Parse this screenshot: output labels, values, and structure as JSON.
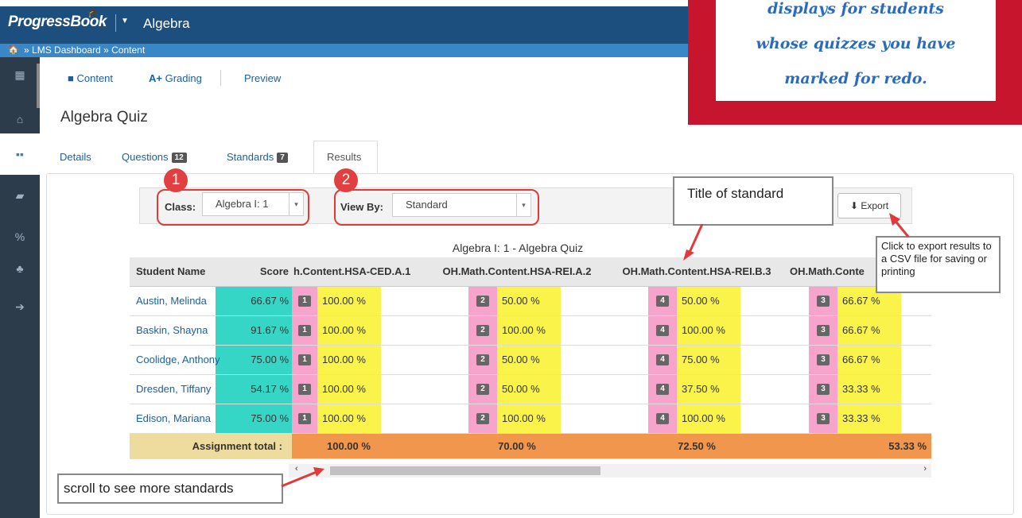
{
  "header": {
    "brand": "ProgressBook",
    "app": "Algebra"
  },
  "breadcrumb": {
    "home_icon": "home-icon",
    "items": [
      "LMS Dashboard",
      "Content"
    ],
    "separator": "»"
  },
  "toolbar": {
    "content": "Content",
    "grading": "Grading",
    "preview": "Preview"
  },
  "page_title": "Algebra Quiz",
  "tabs": [
    {
      "label": "Details"
    },
    {
      "label": "Questions",
      "badge": "12"
    },
    {
      "label": "Standards",
      "badge": "7"
    },
    {
      "label": "Results"
    }
  ],
  "filters": {
    "class_label": "Class:",
    "class_value": "Algebra I: 1",
    "viewby_label": "View By:",
    "viewby_value": "Standard",
    "export_label": "Export"
  },
  "grid_title": "Algebra I: 1 - Algebra Quiz",
  "columns": [
    "Student Name",
    "Score",
    "h.Content.HSA-CED.A.1",
    "OH.Math.Content.HSA-REI.A.2",
    "OH.Math.Content.HSA-REI.B.3",
    "OH.Math.Conte"
  ],
  "rows": [
    {
      "name": "Austin, Melinda",
      "score": "66.67 %",
      "vals": [
        [
          "1",
          "100.00 %"
        ],
        [
          "2",
          "50.00 %"
        ],
        [
          "4",
          "50.00 %"
        ],
        [
          "3",
          "66.67 %"
        ]
      ]
    },
    {
      "name": "Baskin, Shayna",
      "score": "91.67 %",
      "vals": [
        [
          "1",
          "100.00 %"
        ],
        [
          "2",
          "100.00 %"
        ],
        [
          "4",
          "100.00 %"
        ],
        [
          "3",
          "66.67 %"
        ]
      ]
    },
    {
      "name": "Coolidge, Anthony",
      "score": "75.00 %",
      "vals": [
        [
          "1",
          "100.00 %"
        ],
        [
          "2",
          "50.00 %"
        ],
        [
          "4",
          "75.00 %"
        ],
        [
          "3",
          "66.67 %"
        ]
      ]
    },
    {
      "name": "Dresden, Tiffany",
      "score": "54.17 %",
      "vals": [
        [
          "1",
          "100.00 %"
        ],
        [
          "2",
          "50.00 %"
        ],
        [
          "4",
          "37.50 %"
        ],
        [
          "3",
          "33.33 %"
        ]
      ]
    },
    {
      "name": "Edison, Mariana",
      "score": "75.00 %",
      "vals": [
        [
          "1",
          "100.00 %"
        ],
        [
          "2",
          "100.00 %"
        ],
        [
          "4",
          "100.00 %"
        ],
        [
          "3",
          "33.33 %"
        ]
      ]
    }
  ],
  "totals": {
    "label": "Assignment total :",
    "values": [
      "100.00 %",
      "70.00 %",
      "72.50 %",
      "53.33 %"
    ]
  },
  "annotations": {
    "step1": "1",
    "step2": "2",
    "title_callout": "Title of standard",
    "export_callout": "Click to export results to a CSV file for saving or printing",
    "scroll_callout": "scroll to see more standards",
    "red_box_lines": [
      "displays for students",
      "whose quizzes you have",
      "marked for redo."
    ]
  },
  "colors": {
    "score": "#35d6c6",
    "pink": "#f7a4cd",
    "yellow": "#f9f34a",
    "total": "#f0974d",
    "accent_red": "#c8152e"
  }
}
